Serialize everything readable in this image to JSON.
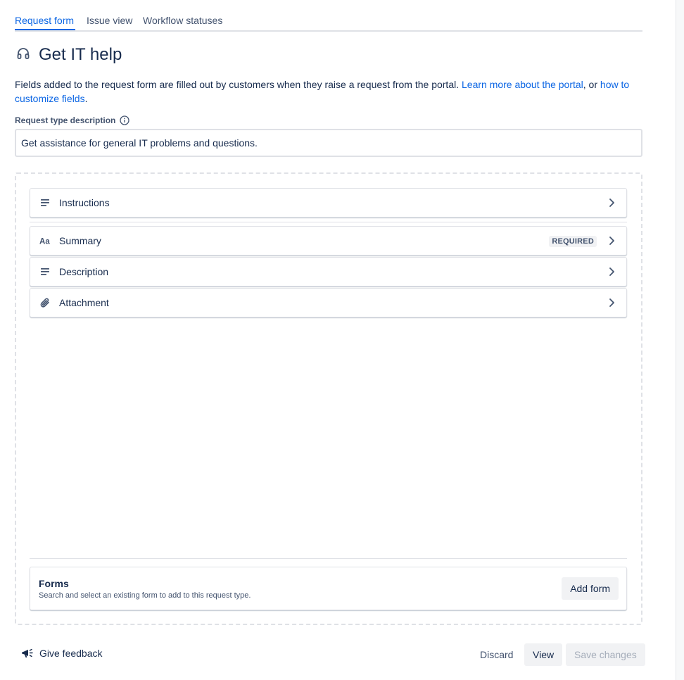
{
  "tabs": [
    {
      "label": "Request form",
      "active": true
    },
    {
      "label": "Issue view",
      "active": false
    },
    {
      "label": "Workflow statuses",
      "active": false
    }
  ],
  "page": {
    "title": "Get IT help",
    "title_icon": "headset-icon",
    "intro_text": "Fields added to the request form are filled out by customers when they raise a request from the portal. ",
    "intro_link1": "Learn more about the portal",
    "intro_mid": ", or ",
    "intro_link2": "how to customize fields",
    "intro_end": "."
  },
  "description_field": {
    "label": "Request type description",
    "value": "Get assistance for general IT problems and questions."
  },
  "fields": [
    {
      "label": "Instructions",
      "icon": "text-lines-icon",
      "badge": ""
    },
    {
      "label": "Summary",
      "icon": "text-aa-icon",
      "badge": "REQUIRED"
    },
    {
      "label": "Description",
      "icon": "text-lines-icon",
      "badge": ""
    },
    {
      "label": "Attachment",
      "icon": "paperclip-icon",
      "badge": ""
    }
  ],
  "forms": {
    "title": "Forms",
    "subtitle": "Search and select an existing form to add to this request type.",
    "add_button": "Add form"
  },
  "footer": {
    "feedback_label": "Give feedback",
    "discard_label": "Discard",
    "view_label": "View",
    "save_label": "Save changes"
  },
  "colors": {
    "accent": "#0c66e4",
    "text": "#172b4d",
    "border": "#dfe1e6"
  }
}
